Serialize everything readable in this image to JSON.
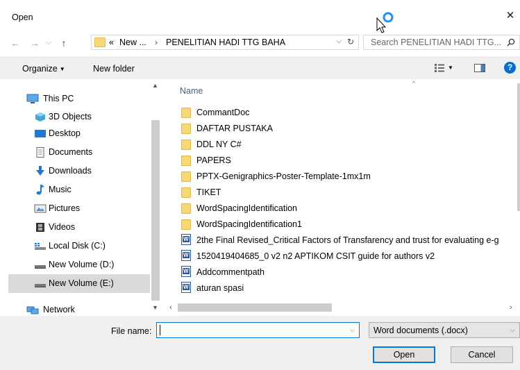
{
  "window": {
    "title": "Open",
    "close_glyph": "✕"
  },
  "nav_buttons": {
    "back": "←",
    "forward": "→",
    "recent": "⌵",
    "up": "↑"
  },
  "address": {
    "overflow": "«",
    "crumb_1": "New ...",
    "separator": "›",
    "crumb_2": "PENELITIAN HADI TTG BAHA",
    "dropdown_glyph": "⌵",
    "refresh_glyph": "↻"
  },
  "search": {
    "placeholder": "Search PENELITIAN HADI TTG..."
  },
  "toolbar": {
    "organize": "Organize",
    "organize_caret": "▼",
    "new_folder": "New folder",
    "view_caret": "▼",
    "help": "?"
  },
  "nav_pane": {
    "items": [
      {
        "label": "This PC",
        "icon": "monitor-icon"
      },
      {
        "label": "3D Objects",
        "icon": "cube-icon"
      },
      {
        "label": "Desktop",
        "icon": "desktop-icon"
      },
      {
        "label": "Documents",
        "icon": "document-icon"
      },
      {
        "label": "Downloads",
        "icon": "download-arrow-icon"
      },
      {
        "label": "Music",
        "icon": "music-note-icon"
      },
      {
        "label": "Pictures",
        "icon": "picture-icon"
      },
      {
        "label": "Videos",
        "icon": "film-icon"
      },
      {
        "label": "Local Disk (C:)",
        "icon": "windows-drive-icon"
      },
      {
        "label": "New Volume (D:)",
        "icon": "drive-icon"
      },
      {
        "label": "New Volume (E:)",
        "icon": "drive-icon",
        "selected": true
      },
      {
        "label": "Network",
        "icon": "network-icon"
      }
    ],
    "scroll_up": "▲",
    "scroll_down": "▼"
  },
  "file_list": {
    "column_name": "Name",
    "sort_glyph": "^",
    "files": [
      {
        "name": "CommantDoc",
        "type": "folder"
      },
      {
        "name": "DAFTAR PUSTAKA",
        "type": "folder"
      },
      {
        "name": "DDL NY C#",
        "type": "folder"
      },
      {
        "name": "PAPERS",
        "type": "folder"
      },
      {
        "name": "PPTX-Genigraphics-Poster-Template-1mx1m",
        "type": "folder"
      },
      {
        "name": "TIKET",
        "type": "folder"
      },
      {
        "name": "WordSpacingIdentification",
        "type": "folder"
      },
      {
        "name": "WordSpacingIdentification1",
        "type": "folder"
      },
      {
        "name": "2the Final Revised_Critical Factors of Transfarency and trust for evaluating e-g",
        "type": "word-document"
      },
      {
        "name": "1520419404685_0 v2 n2 APTIKOM CSIT guide for authors v2",
        "type": "word-document"
      },
      {
        "name": "Addcommentpath",
        "type": "word-document"
      },
      {
        "name": "aturan spasi",
        "type": "word-document"
      }
    ],
    "scroll_left": "‹",
    "scroll_right": "›"
  },
  "bottom": {
    "file_name_label": "File name:",
    "file_name_value": "",
    "file_name_chevron": "⌵",
    "file_type": "Word documents (.docx)",
    "file_type_chevron": "⌵",
    "open_label": "Open",
    "cancel_label": "Cancel"
  }
}
